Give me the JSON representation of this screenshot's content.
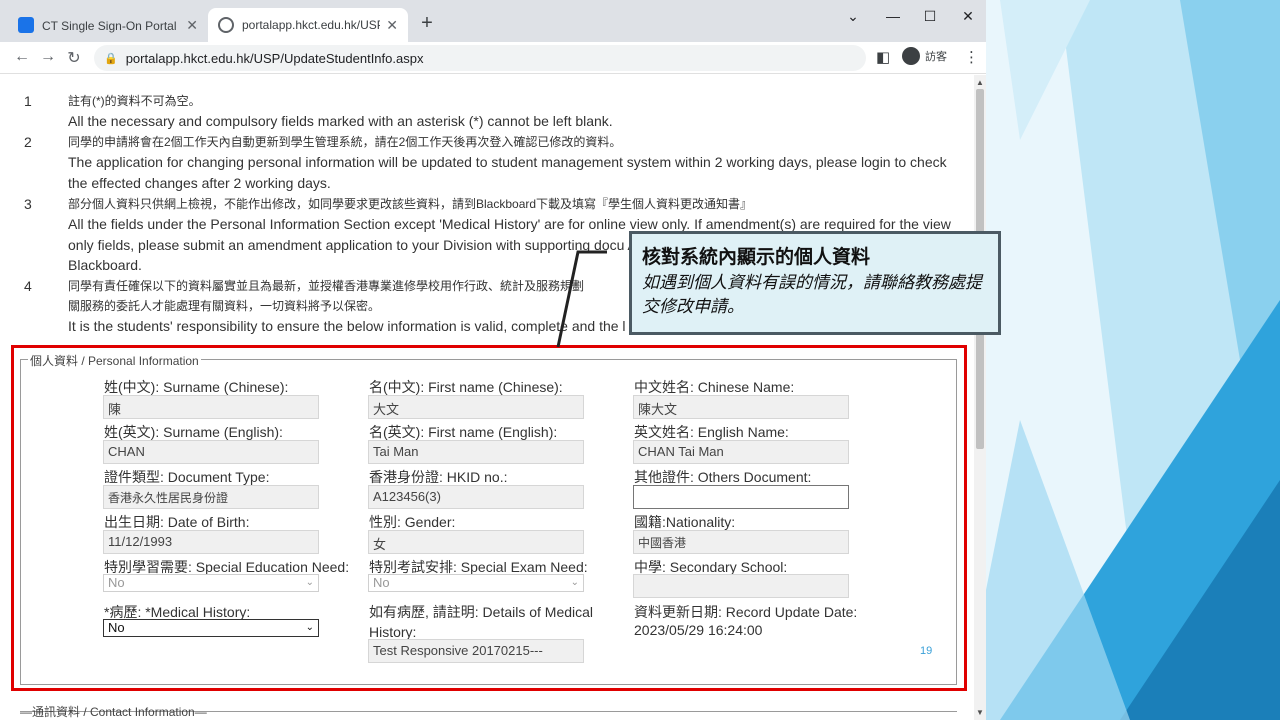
{
  "browser": {
    "tabs": [
      {
        "title": "CT Single Sign-On Portal - 首頁",
        "active": false,
        "favicon_color": "#1a73e8"
      },
      {
        "title": "portalapp.hkct.edu.hk/USP/Up",
        "active": true,
        "favicon_color": "#5f6368"
      }
    ],
    "url": "portalapp.hkct.edu.hk/USP/UpdateStudentInfo.aspx",
    "profile_label": "訪客"
  },
  "notes": [
    {
      "num": "1",
      "zh": "註有(*)的資料不可為空。",
      "en": "All the necessary and compulsory fields marked with an asterisk (*) cannot be left blank."
    },
    {
      "num": "2",
      "zh": "同學的申請將會在2個工作天內自動更新到學生管理系統，請在2個工作天後再次登入確認已修改的資料。",
      "en": "The application for changing personal information will be updated to student management system within 2 working days, please login to check the effected changes after 2 working days."
    },
    {
      "num": "3",
      "zh": "部分個人資料只供網上檢視，不能作出修改，如同學要求更改該些資料，請到Blackboard下載及填寫『學生個人資料更改通知書』",
      "en": "All the fields under the Personal Information Section except 'Medical History' are for online view only. If amendment(s) are required for the view only fields, please submit an amendment application to your Division with supporting docu Amendment form\" can be downloaded from Blackboard."
    },
    {
      "num": "4",
      "zh": "同學有責任確保以下的資料屬實並且為最新，並授權香港專業進修學校用作行政、統計及服務規劃",
      "zh2": "關服務的委託人才能處理有關資料，一切資料將予以保密。",
      "en": "It is the students' responsibility to ensure the below information is valid, complete and the l"
    }
  ],
  "personal_info": {
    "legend": "個人資料 / Personal Information",
    "fields": {
      "surname_zh": {
        "label": "姓(中文): Surname (Chinese):",
        "value": "陳"
      },
      "firstname_zh": {
        "label": "名(中文): First name (Chinese):",
        "value": "大文"
      },
      "chinese_name": {
        "label": "中文姓名: Chinese Name:",
        "value": "陳大文"
      },
      "surname_en": {
        "label": "姓(英文): Surname (English):",
        "value": "CHAN"
      },
      "firstname_en": {
        "label": "名(英文): First name (English):",
        "value": "Tai Man"
      },
      "english_name": {
        "label": "英文姓名: English Name:",
        "value": "CHAN Tai Man"
      },
      "doc_type": {
        "label": "證件類型: Document Type:",
        "value": "香港永久性居民身份證"
      },
      "hkid": {
        "label": "香港身份證: HKID no.:",
        "value": "A123456(3)"
      },
      "others_doc": {
        "label": "其他證件: Others Document:",
        "value": ""
      },
      "dob": {
        "label": "出生日期: Date of Birth:",
        "value": "11/12/1993"
      },
      "gender": {
        "label": "性別: Gender:",
        "value": "女"
      },
      "nationality": {
        "label": "國籍:Nationality:",
        "value": "中國香港"
      },
      "special_edu": {
        "label": "特別學習需要: Special Education Need:",
        "value": "No"
      },
      "special_exam": {
        "label": "特別考試安排: Special Exam Need:",
        "value": "No"
      },
      "secondary": {
        "label": "中學: Secondary School:",
        "value": ""
      },
      "medical": {
        "label": "*病歷: *Medical History:",
        "value": "No"
      },
      "medical_details": {
        "label": "如有病歷, 請註明: Details of Medical History:",
        "value": "Test Responsive 20170215---"
      },
      "record_update": {
        "label": "資料更新日期: Record Update Date:",
        "value": "2023/05/29 16:24:00"
      }
    },
    "page_number": "19"
  },
  "contact_info": {
    "legend": "通訊資料 / Contact Information"
  },
  "callout": {
    "title": "核對系統內顯示的個人資料",
    "body": "如遇到個人資料有誤的情況，請聯絡教務處提交修改申請。"
  },
  "colors": {
    "highlight_red": "#e00000",
    "callout_bg": "#dff1f6",
    "slide_accent": "#2fa3dc"
  }
}
